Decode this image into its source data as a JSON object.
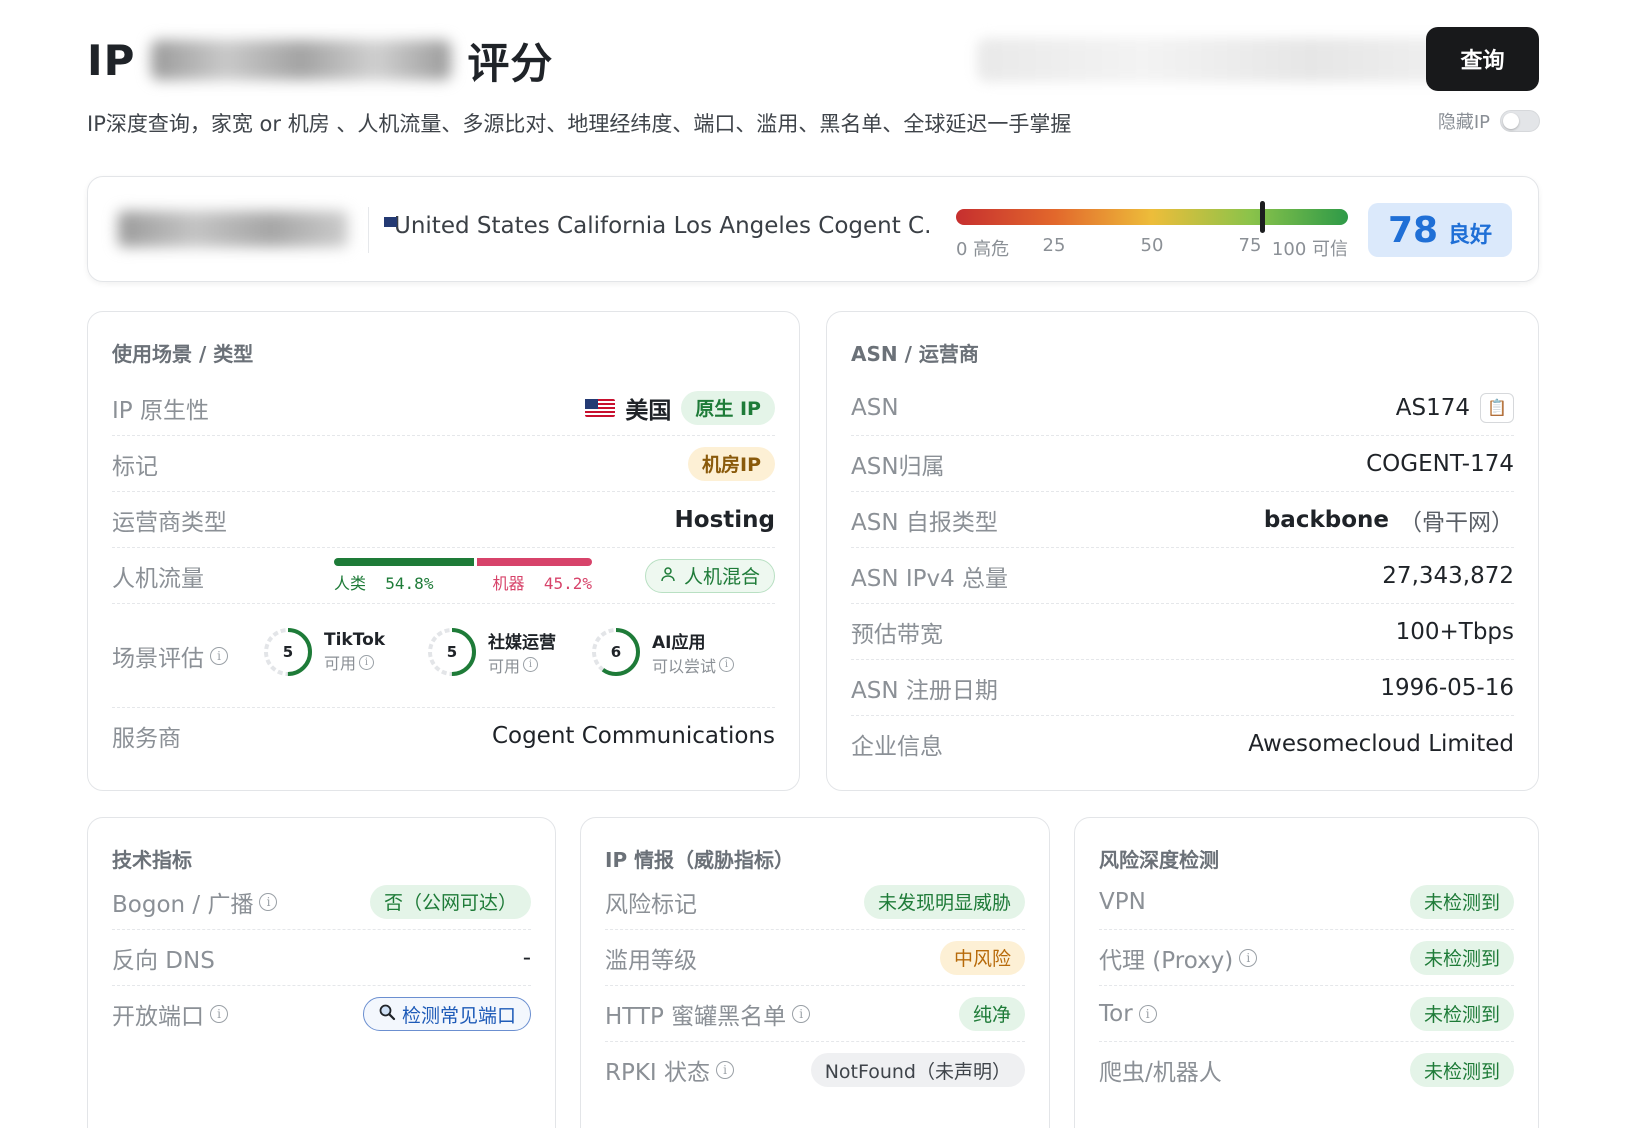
{
  "header": {
    "title_prefix": "IP",
    "title_suffix": "评分",
    "query_button": "查询",
    "subtitle": "IP深度查询，家宽 or 机房 、人机流量、多源比对、地理经纬度、端口、滥用、黑名单、全球延迟一手掌握",
    "hide_ip_label": "隐藏IP"
  },
  "summary": {
    "location": "United States California Los Angeles Cogent C...",
    "gauge": {
      "ticks": [
        "0 高危",
        "25",
        "50",
        "75",
        "100 可信"
      ],
      "score_value": 78
    },
    "score": "78",
    "score_label": "良好"
  },
  "usage_card": {
    "title": "使用场景 / 类型",
    "native": {
      "label": "IP 原生性",
      "country": "美国",
      "badge": "原生 IP"
    },
    "tag": {
      "label": "标记",
      "badge": "机房IP"
    },
    "carrier_type": {
      "label": "运营商类型",
      "value": "Hosting"
    },
    "traffic": {
      "label": "人机流量",
      "human_label": "人类",
      "human_pct": "54.8%",
      "bot_label": "机器",
      "bot_pct": "45.2%",
      "human_value": 54.8,
      "badge": "人机混合"
    },
    "scenario": {
      "label": "场景评估",
      "items": [
        {
          "score": "5",
          "name": "TikTok",
          "status": "可用",
          "level": 5
        },
        {
          "score": "5",
          "name": "社媒运营",
          "status": "可用",
          "level": 5
        },
        {
          "score": "6",
          "name": "AI应用",
          "status": "可以尝试",
          "level": 6
        }
      ]
    },
    "provider": {
      "label": "服务商",
      "value": "Cogent Communications"
    }
  },
  "asn_card": {
    "title": "ASN / 运营商",
    "rows": [
      {
        "label": "ASN",
        "value": "AS174"
      },
      {
        "label": "ASN归属",
        "value": "COGENT-174"
      },
      {
        "label": "ASN 自报类型",
        "value": "backbone",
        "note": "（骨干网）"
      },
      {
        "label": "ASN IPv4 总量",
        "value": "27,343,872"
      },
      {
        "label": "预估带宽",
        "value": "100+Tbps"
      },
      {
        "label": "ASN 注册日期",
        "value": "1996-05-16"
      },
      {
        "label": "企业信息",
        "value": "Awesomecloud Limited"
      }
    ]
  },
  "tech_card": {
    "title": "技术指标",
    "rows": [
      {
        "label": "Bogon / 广播",
        "value": "否（公网可达）"
      },
      {
        "label": "反向 DNS",
        "value": "-"
      },
      {
        "label": "开放端口",
        "value": "检测常见端口"
      }
    ]
  },
  "intel_card": {
    "title": "IP 情报（威胁指标）",
    "rows": [
      {
        "label": "风险标记",
        "value": "未发现明显威胁"
      },
      {
        "label": "滥用等级",
        "value": "中风险"
      },
      {
        "label": "HTTP 蜜罐黑名单",
        "value": "纯净"
      },
      {
        "label": "RPKI 状态",
        "value": "NotFound（未声明）"
      }
    ]
  },
  "risk_card": {
    "title": "风险深度检测",
    "rows": [
      {
        "label": "VPN",
        "value": "未检测到"
      },
      {
        "label": "代理 (Proxy)",
        "value": "未检测到"
      },
      {
        "label": "Tor",
        "value": "未检测到"
      },
      {
        "label": "爬虫/机器人",
        "value": "未检测到"
      }
    ]
  },
  "colors": {
    "accent_blue": "#1f6fd6",
    "success_green": "#1e7b38",
    "bot_pink": "#d7436a",
    "warning_orange": "#b76a0a"
  }
}
